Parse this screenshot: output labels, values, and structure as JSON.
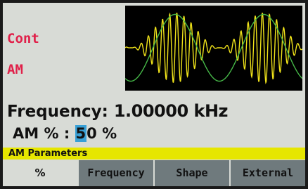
{
  "mode": {
    "line1": "Cont",
    "line2": "AM"
  },
  "waveform": {
    "carrier_color": "#f0e31a",
    "envelope_color": "#46b848",
    "background": "#000000"
  },
  "frequency": {
    "label": "Frequency:",
    "value": "1.00000 kHz"
  },
  "am_depth": {
    "label": "AM % :",
    "digit_cursor": "5",
    "digit_rest": "0",
    "unit": "%"
  },
  "params_bar": {
    "title": "AM Parameters",
    "color": "#e6e600"
  },
  "softkeys": [
    {
      "label": "%"
    },
    {
      "label": "Frequency"
    },
    {
      "label": "Shape"
    },
    {
      "label": "External"
    }
  ]
}
